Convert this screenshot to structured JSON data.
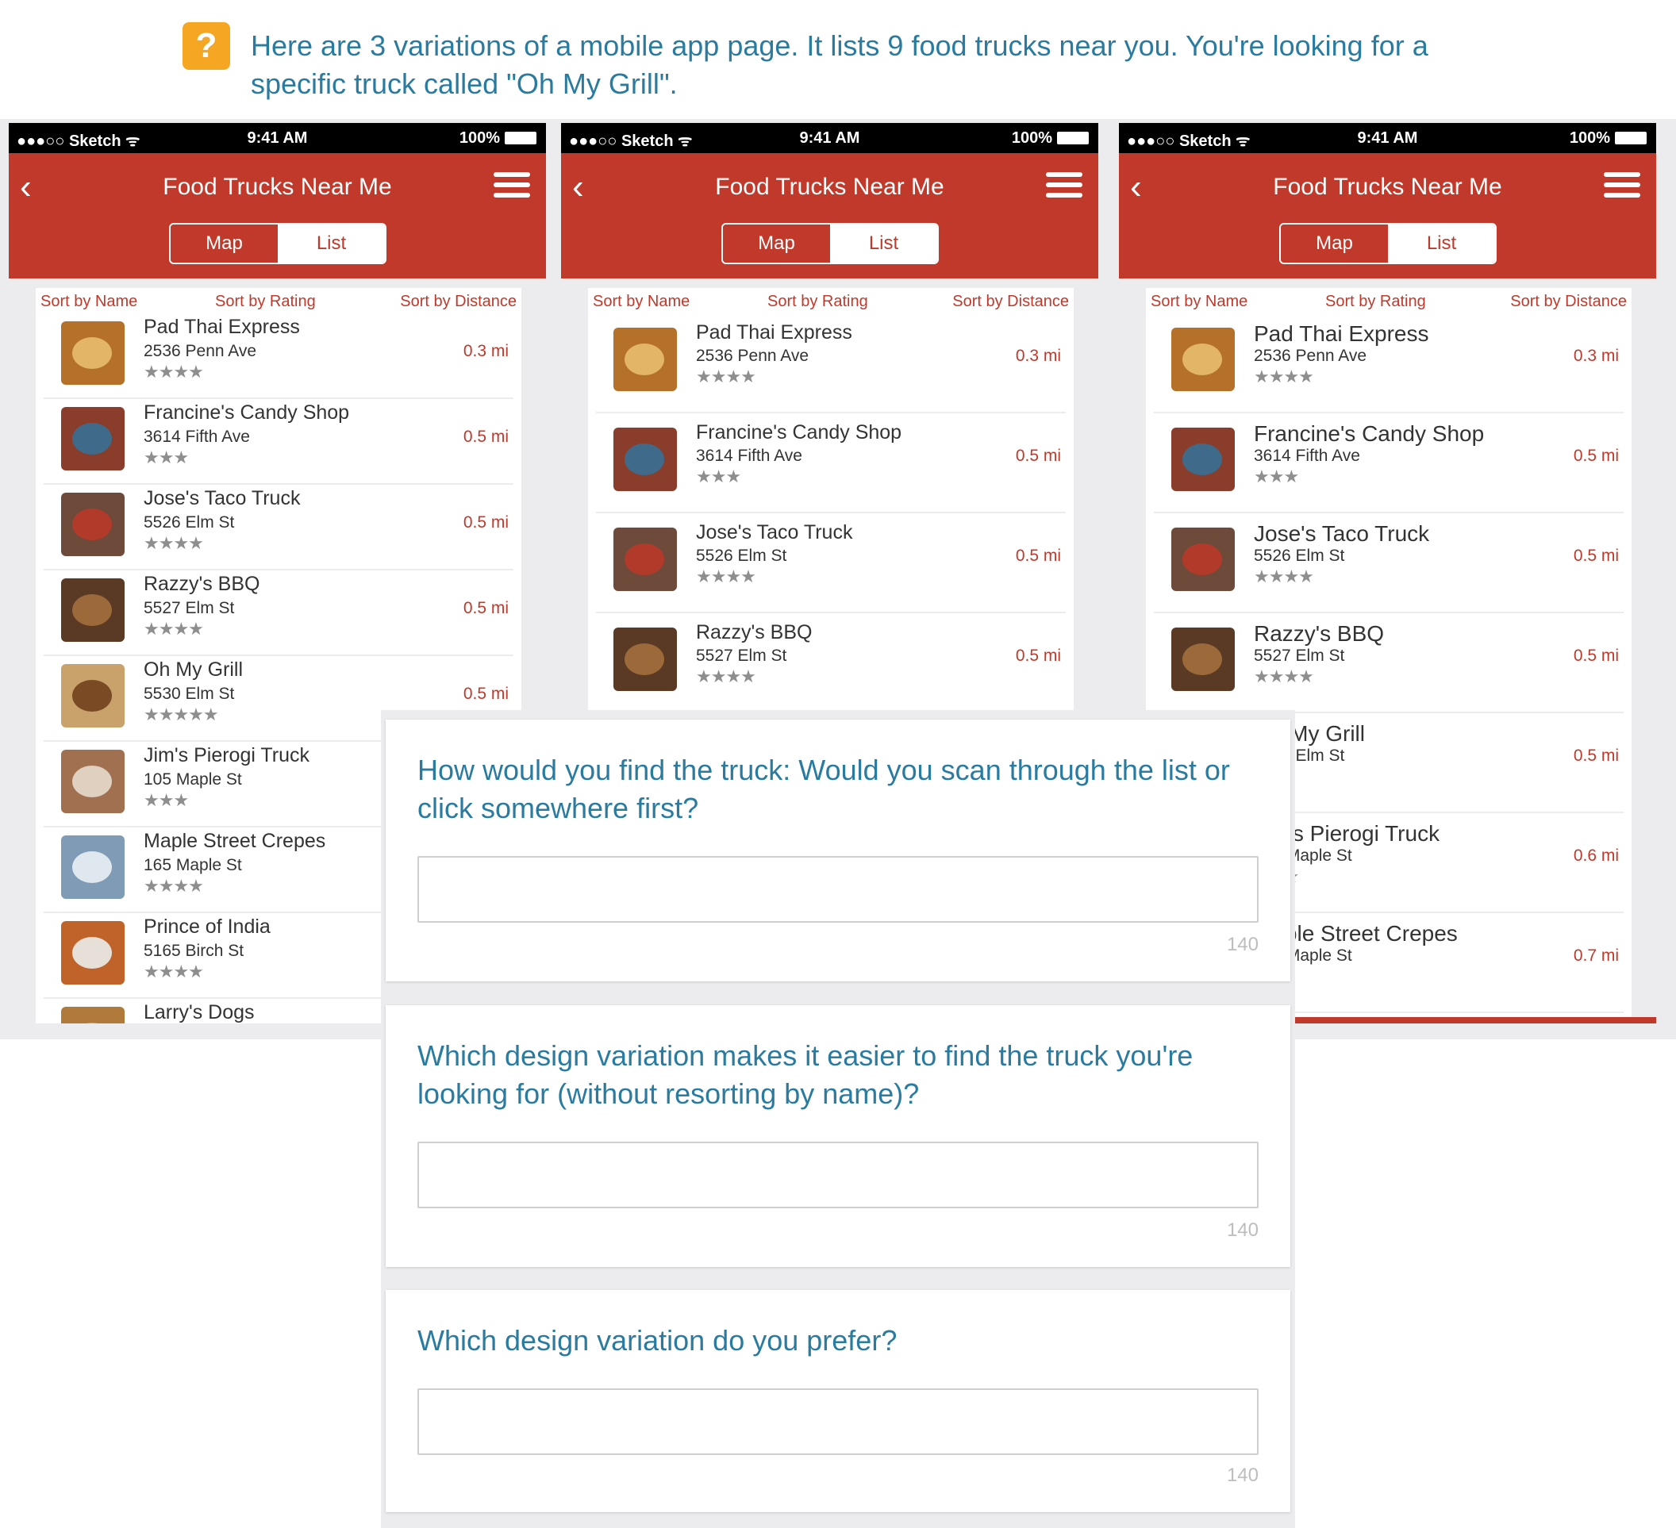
{
  "prompt": {
    "icon": "help-icon",
    "text": "Here are 3 variations of a mobile app page. It lists 9 food trucks near you. You're looking for a specific truck called \"Oh My Grill\"."
  },
  "statusbar": {
    "carrier": "●●●○○ Sketch ᯤ",
    "time": "9:41 AM",
    "battery": "100%"
  },
  "navbar": {
    "back": "‹",
    "title": "Food Trucks Near Me",
    "map": "Map",
    "list": "List"
  },
  "sort": {
    "name": "Sort by Name",
    "rating": "Sort by Rating",
    "distance": "Sort by Distance"
  },
  "phones": [
    {
      "items": [
        {
          "name": "Pad Thai Express",
          "address": "2536 Penn Ave",
          "distance": "0.3 mi",
          "stars": "★★★★"
        },
        {
          "name": "Francine's Candy Shop",
          "address": "3614 Fifth Ave",
          "distance": "0.5 mi",
          "stars": "★★★"
        },
        {
          "name": "Jose's Taco Truck",
          "address": "5526 Elm St",
          "distance": "0.5 mi",
          "stars": "★★★★"
        },
        {
          "name": "Razzy's BBQ",
          "address": "5527 Elm St",
          "distance": "0.5 mi",
          "stars": "★★★★"
        },
        {
          "name": "Oh My Grill",
          "address": "5530 Elm St",
          "distance": "0.5 mi",
          "stars": "★★★★★"
        },
        {
          "name": "Jim's Pierogi Truck",
          "address": "105 Maple St",
          "distance": "",
          "stars": "★★★"
        },
        {
          "name": "Maple Street Crepes",
          "address": "165 Maple St",
          "distance": "",
          "stars": "★★★★"
        },
        {
          "name": "Prince of India",
          "address": "5165 Birch St",
          "distance": "",
          "stars": "★★★★"
        },
        {
          "name": "Larry's Dogs",
          "address": "",
          "distance": "",
          "stars": ""
        }
      ]
    },
    {
      "items": [
        {
          "name": "Pad Thai Express",
          "address": "2536 Penn Ave",
          "distance": "0.3 mi",
          "stars": "★★★★"
        },
        {
          "name": "Francine's Candy Shop",
          "address": "3614 Fifth Ave",
          "distance": "0.5 mi",
          "stars": "★★★"
        },
        {
          "name": "Jose's Taco Truck",
          "address": "5526 Elm St",
          "distance": "0.5 mi",
          "stars": "★★★★"
        },
        {
          "name": "Razzy's BBQ",
          "address": "5527 Elm St",
          "distance": "0.5 mi",
          "stars": "★★★★"
        }
      ]
    },
    {
      "items": [
        {
          "name": "Pad Thai Express",
          "address": "2536 Penn Ave",
          "distance": "0.3 mi",
          "stars": "★★★★"
        },
        {
          "name": "Francine's Candy Shop",
          "address": "3614 Fifth Ave",
          "distance": "0.5 mi",
          "stars": "★★★"
        },
        {
          "name": "Jose's Taco Truck",
          "address": "5526 Elm St",
          "distance": "0.5 mi",
          "stars": "★★★★"
        },
        {
          "name": "Razzy's BBQ",
          "address": "5527 Elm St",
          "distance": "0.5 mi",
          "stars": "★★★★"
        },
        {
          "name": "Oh My Grill",
          "address": "5530 Elm St",
          "distance": "0.5 mi",
          "stars": "★★"
        },
        {
          "name": "Jim's Pierogi Truck",
          "address": "105 Maple St",
          "distance": "0.6 mi",
          "stars": "★★★"
        },
        {
          "name": "Maple Street Crepes",
          "address": "165 Maple St",
          "distance": "0.7 mi",
          "stars": "★"
        }
      ]
    }
  ],
  "questions": [
    {
      "text": "How would you find the truck: Would you scan through the list or click somewhere first?",
      "count": "140"
    },
    {
      "text": "Which design variation makes it easier to find the truck you're looking for (without resorting by name)?",
      "count": "140"
    },
    {
      "text": "Which design variation do you prefer?",
      "count": "140"
    }
  ],
  "colors": {
    "accent": "#c0392b",
    "question_text": "#2a7ba0",
    "help_icon": "#f5a623"
  },
  "thumb_colors": [
    [
      "#b5702a",
      "#e3b566"
    ],
    [
      "#8a3d2b",
      "#3f6a8a"
    ],
    [
      "#6e4a3a",
      "#b23a2a"
    ],
    [
      "#5a3a25",
      "#9c6a3a"
    ],
    [
      "#c9a16a",
      "#7a4a25"
    ],
    [
      "#a07050",
      "#e0d0c0"
    ],
    [
      "#7f9bb6",
      "#dfe7ef"
    ],
    [
      "#c0632a",
      "#e6e0d8"
    ],
    [
      "#b07a3a",
      "#d9a060"
    ]
  ]
}
